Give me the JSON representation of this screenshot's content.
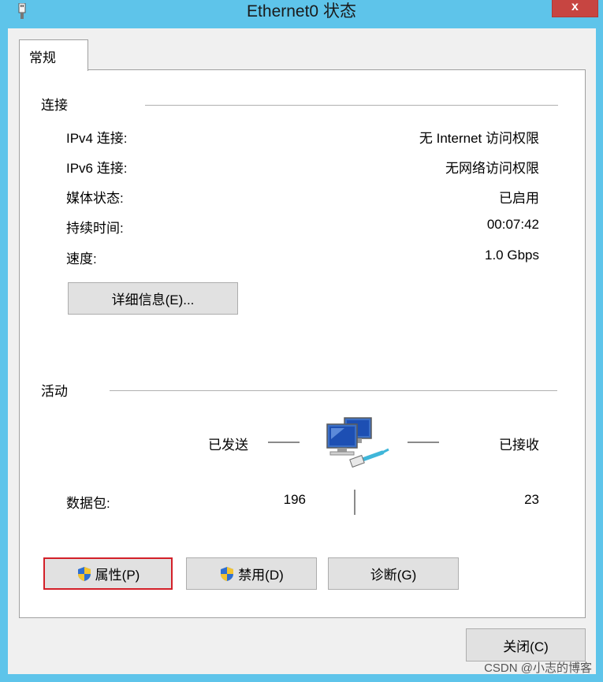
{
  "window": {
    "title": "Ethernet0 状态",
    "close_glyph": "x"
  },
  "tabs": [
    {
      "label": "常规"
    }
  ],
  "connection": {
    "section_title": "连接",
    "rows": [
      {
        "label": "IPv4 连接:",
        "value": "无 Internet 访问权限"
      },
      {
        "label": "IPv6 连接:",
        "value": "无网络访问权限"
      },
      {
        "label": "媒体状态:",
        "value": "已启用"
      },
      {
        "label": "持续时间:",
        "value": "00:07:42"
      },
      {
        "label": "速度:",
        "value": "1.0 Gbps"
      }
    ],
    "details_button": "详细信息(E)..."
  },
  "activity": {
    "section_title": "活动",
    "sent_label": "已发送",
    "received_label": "已接收",
    "packets_label": "数据包:",
    "packets_sent": "196",
    "packets_received": "23"
  },
  "actions": {
    "properties_button": "属性(P)",
    "disable_button": "禁用(D)",
    "diagnose_button": "诊断(G)"
  },
  "footer": {
    "close_button": "关闭(C)"
  },
  "watermark": "CSDN @小志的博客",
  "colors": {
    "titlebar": "#5ec4ea",
    "close_button": "#c74541",
    "focus_outline": "#d32029"
  }
}
